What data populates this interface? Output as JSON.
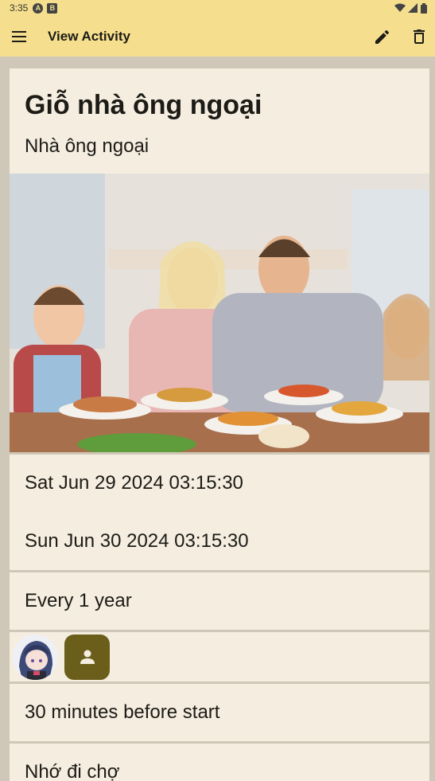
{
  "status_bar": {
    "time": "3:35",
    "icon_a": "A",
    "icon_b": "B"
  },
  "toolbar": {
    "title": "View Activity"
  },
  "activity": {
    "title": "Giỗ nhà ông ngoại",
    "location": "Nhà ông ngoại",
    "start": "Sat Jun 29 2024 03:15:30",
    "end": "Sun Jun 30 2024 03:15:30",
    "repeat": "Every 1 year",
    "reminder": "30 minutes before start",
    "note": "Nhớ đi chợ"
  },
  "colors": {
    "app_bar": "#f5df8e",
    "card": "#f4ede0",
    "background": "#cfc8b8",
    "accent": "#6b5e1b"
  },
  "icons": [
    "menu-icon",
    "edit-icon",
    "delete-icon",
    "person-icon",
    "wifi-icon",
    "signal-icon",
    "battery-icon"
  ]
}
